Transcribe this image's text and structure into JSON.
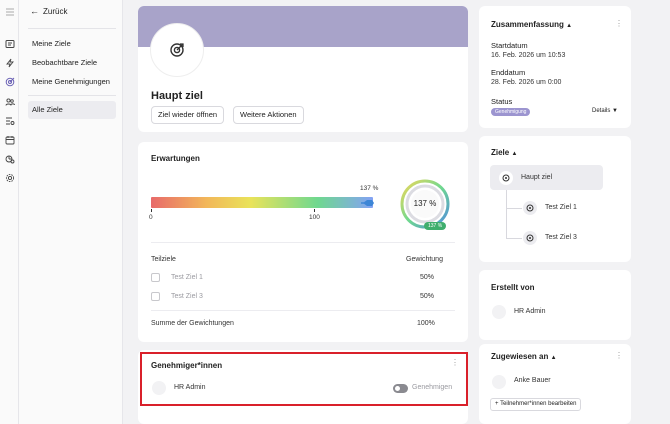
{
  "sidebar": {
    "back_label": "Zurück",
    "items": [
      {
        "label": "Meine Ziele"
      },
      {
        "label": "Beobachtbare Ziele"
      },
      {
        "label": "Meine Genehmigungen"
      },
      {
        "label": "Alle Ziele"
      }
    ],
    "active_index": 3
  },
  "goal": {
    "title": "Haupt ziel",
    "reopen_button": "Ziel wieder öffnen",
    "more_actions_button": "Weitere Aktionen"
  },
  "expectations": {
    "title": "Erwartungen",
    "progress_label": "137 %",
    "progress_value": 137,
    "scale_min": "0",
    "scale_mid": "100",
    "gauge_label": "137 %",
    "gauge_badge": "137 %"
  },
  "subgoals": {
    "col_name": "Teilziele",
    "col_weight": "Gewichtung",
    "rows": [
      {
        "name": "Test Ziel 1",
        "weight": "50%"
      },
      {
        "name": "Test Ziel 3",
        "weight": "50%"
      }
    ],
    "sum_label": "Summe der Gewichtungen",
    "sum_value": "100%"
  },
  "approvers": {
    "title": "Genehmiger*innen",
    "name": "HR Admin",
    "action_label": "Genehmigen"
  },
  "summary": {
    "title": "Zusammenfassung",
    "start_label": "Startdatum",
    "start_value": "16. Feb. 2026 um 10:53",
    "end_label": "Enddatum",
    "end_value": "28. Feb. 2026 um 0:00",
    "status_label": "Status",
    "status_value": "Genehmigung",
    "details_label": "Details"
  },
  "goals_tree": {
    "title": "Ziele",
    "root": "Haupt ziel",
    "children": [
      "Test Ziel 1",
      "Test Ziel 3"
    ]
  },
  "created_by": {
    "title": "Erstellt von",
    "name": "HR Admin"
  },
  "assigned_to": {
    "title": "Zugewiesen an",
    "name": "Anke Bauer",
    "edit_button": "Teilnehmer*innen bearbeiten"
  },
  "colors": {
    "accent": "#6a61b5",
    "hero": "#a8a3c9",
    "highlight": "#d9202a"
  }
}
